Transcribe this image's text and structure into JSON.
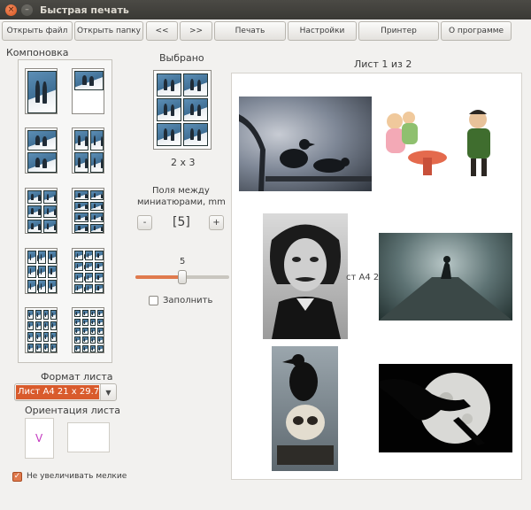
{
  "window": {
    "title": "Быстрая печать",
    "close_glyph": "×",
    "min_glyph": "–"
  },
  "toolbar": {
    "open_file": "Открыть файл",
    "open_folder": "Открыть папку",
    "prev": "<<",
    "next": ">>",
    "print": "Печать",
    "settings": "Настройки",
    "printer": "Принтер",
    "about": "О программе"
  },
  "layout": {
    "title": "Компоновка",
    "options": [
      {
        "grid": "1x1"
      },
      {
        "grid": "1x1-top"
      },
      {
        "grid": "1x2"
      },
      {
        "grid": "2x2"
      },
      {
        "grid": "2x3"
      },
      {
        "grid": "2x4"
      },
      {
        "grid": "3x3"
      },
      {
        "grid": "3x4"
      },
      {
        "grid": "4x4"
      },
      {
        "grid": "4x5"
      }
    ],
    "selected_index": 4
  },
  "selected": {
    "title": "Выбрано",
    "grid": "2 x 3"
  },
  "spacing": {
    "label_line1": "Поля между",
    "label_line2": "миниатюрами, mm",
    "minus": "-",
    "plus": "+",
    "value": "[5]",
    "slider_value": "5",
    "slider_fraction": 0.5
  },
  "fill": {
    "label": "Заполнить",
    "checked": false
  },
  "sheet_format": {
    "label": "Формат листа",
    "value": "Лист А4 21 x 29.7",
    "arrow": "▼"
  },
  "orientation": {
    "label": "Ориентация листа",
    "portrait_glyph": "V"
  },
  "no_upscale": {
    "label": "Не увеличивать мелкие",
    "checked": true,
    "check_glyph": "✓"
  },
  "preview": {
    "title": "Лист 1 из 2",
    "overlay_text": "ст А4 2"
  },
  "colors": {
    "accent": "#e07a4d",
    "select_highlight": "#d95b2c",
    "titlebar": "#3c3b37"
  }
}
